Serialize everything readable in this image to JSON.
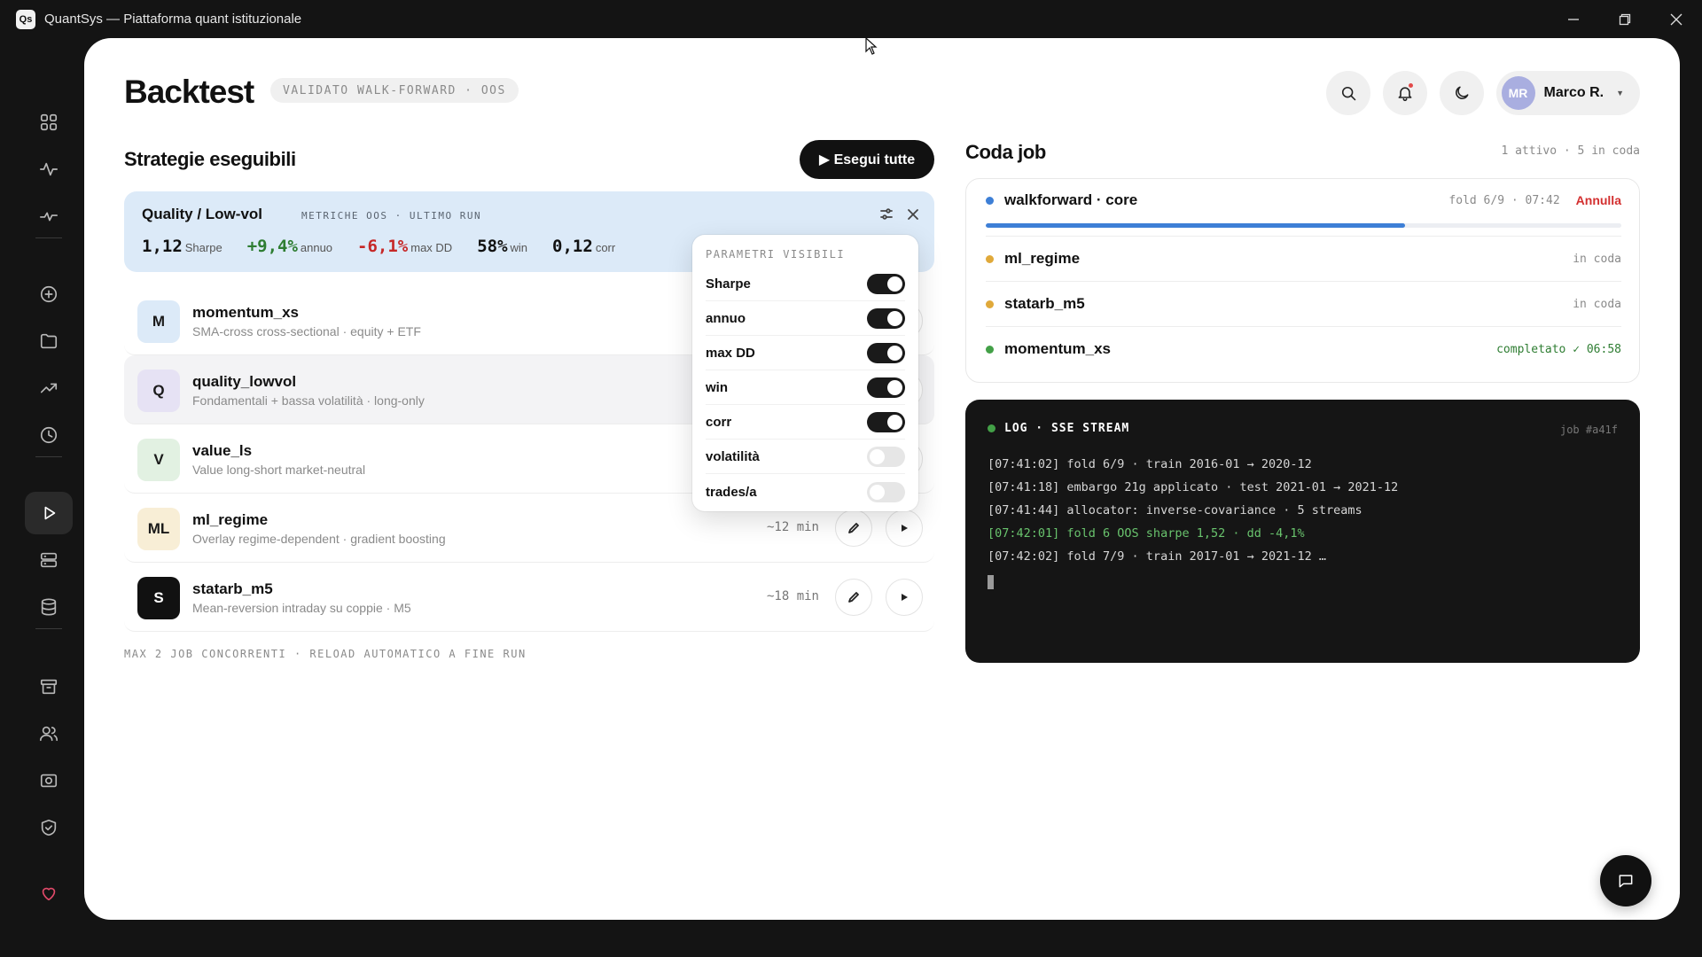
{
  "window": {
    "logo": "Qs",
    "title": "QuantSys — Piattaforma quant istituzionale"
  },
  "header": {
    "title": "Backtest",
    "badge": "VALIDATO WALK-FORWARD · OOS",
    "user_initials": "MR",
    "user_name": "Marco R."
  },
  "strategies": {
    "title": "Strategie eseguibili",
    "run_all_label": "▶ Esegui tutte",
    "summary": {
      "name": "Quality / Low-vol",
      "meta": "METRICHE OOS · ULTIMO RUN",
      "stats": [
        {
          "value": "1,12",
          "label": "Sharpe",
          "tone": "plain"
        },
        {
          "value": "+9,4%",
          "label": "annuo",
          "tone": "pos"
        },
        {
          "value": "-6,1%",
          "label": "max DD",
          "tone": "neg"
        },
        {
          "value": "58%",
          "label": "win",
          "tone": "plain"
        },
        {
          "value": "0,12",
          "label": "corr",
          "tone": "plain"
        }
      ]
    },
    "items": [
      {
        "badge": "M",
        "name": "momentum_xs",
        "desc": "SMA-cross cross-sectional · equity + ETF",
        "eta": "",
        "bg": "#dceaf8",
        "fg": "#1a1a1a"
      },
      {
        "badge": "Q",
        "name": "quality_lowvol",
        "desc": "Fondamentali + bassa volatilità · long-only",
        "eta": "",
        "bg": "#e6e2f4",
        "fg": "#1a1a1a"
      },
      {
        "badge": "V",
        "name": "value_ls",
        "desc": "Value long-short market-neutral",
        "eta": "",
        "bg": "#e2f1e2",
        "fg": "#1a1a1a"
      },
      {
        "badge": "ML",
        "name": "ml_regime",
        "desc": "Overlay regime-dependent · gradient boosting",
        "eta": "~12 min",
        "bg": "#f8eed6",
        "fg": "#1a1a1a"
      },
      {
        "badge": "S",
        "name": "statarb_m5",
        "desc": "Mean-reversion intraday su coppie · M5",
        "eta": "~18 min",
        "bg": "#111111",
        "fg": "#ffffff"
      }
    ],
    "footnote": "MAX 2 JOB CONCORRENTI · RELOAD AUTOMATICO A FINE RUN"
  },
  "popover": {
    "title": "PARAMETRI VISIBILI",
    "params": [
      {
        "label": "Sharpe",
        "on": true
      },
      {
        "label": "annuo",
        "on": true
      },
      {
        "label": "max DD",
        "on": true
      },
      {
        "label": "win",
        "on": true
      },
      {
        "label": "corr",
        "on": true
      },
      {
        "label": "volatilità",
        "on": false
      },
      {
        "label": "trades/a",
        "on": false
      }
    ]
  },
  "queue": {
    "title": "Coda job",
    "meta": "1 attivo · 5 in coda",
    "cancel_label": "Annulla",
    "jobs": [
      {
        "name": "walkforward · core",
        "status": "fold 6/9 · 07:42",
        "color": "#3d7fd6",
        "progress": 0.66,
        "state": "running"
      },
      {
        "name": "ml_regime",
        "status": "in coda",
        "color": "#e0a93a",
        "state": "queued"
      },
      {
        "name": "statarb_m5",
        "status": "in coda",
        "color": "#e0a93a",
        "state": "queued"
      },
      {
        "name": "momentum_xs",
        "status": "completato ✓ 06:58",
        "color": "#43a047",
        "state": "done"
      }
    ]
  },
  "log": {
    "title": "LOG · SSE STREAM",
    "job": "job #a41f",
    "lines": [
      {
        "text": "[07:41:02] fold 6/9 · train 2016-01 → 2020-12",
        "tone": "plain"
      },
      {
        "text": "[07:41:18] embargo 21g applicato · test 2021-01 → 2021-12",
        "tone": "plain"
      },
      {
        "text": "[07:41:44] allocator: inverse-covariance · 5 streams",
        "tone": "plain"
      },
      {
        "text": "[07:42:01] fold 6 OOS sharpe 1,52 · dd -4,1%",
        "tone": "green"
      },
      {
        "text": "[07:42:02] fold 7/9 · train 2017-01 → 2021-12 …",
        "tone": "plain"
      }
    ]
  },
  "colors": {
    "accent": "#3d7fd6",
    "positive": "#2e7d32",
    "negative": "#c62828",
    "danger": "#d32f2f"
  }
}
